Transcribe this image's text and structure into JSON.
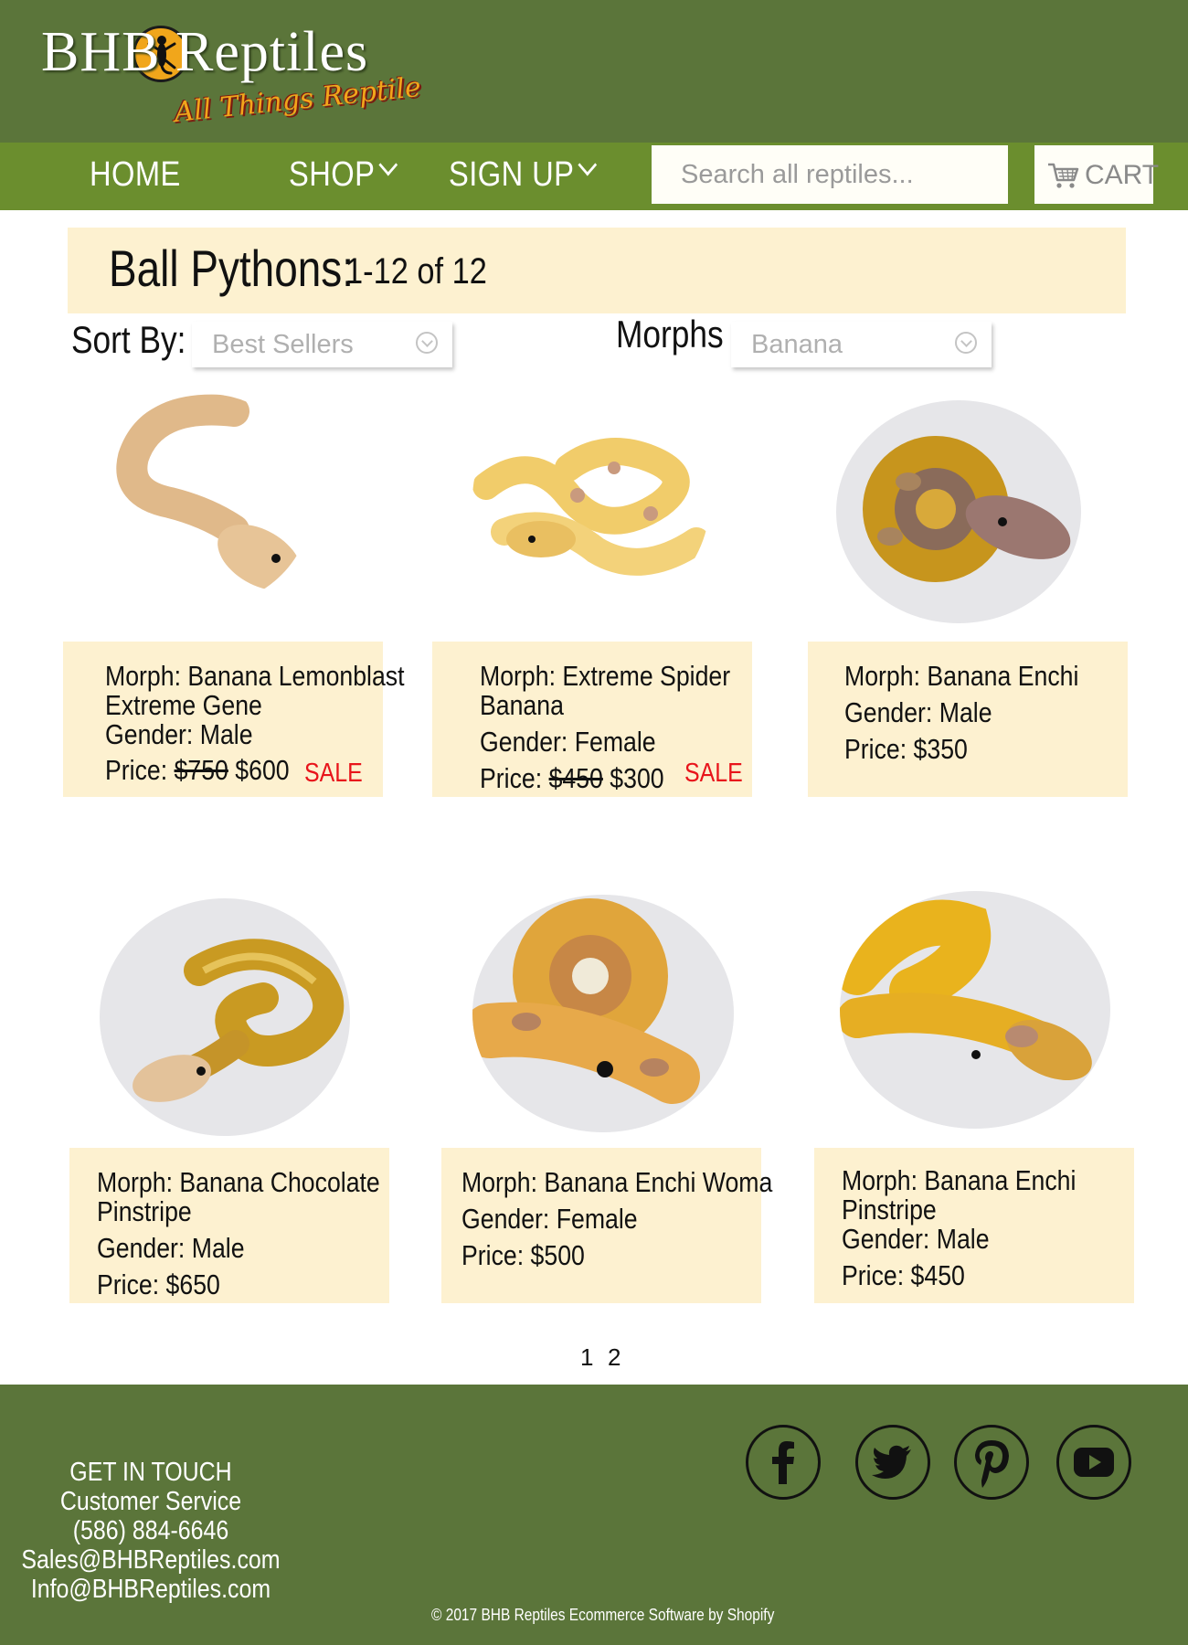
{
  "brand": {
    "name": "BHB Reptiles",
    "tagline": "All Things Reptile"
  },
  "nav": {
    "home": "HOME",
    "shop": "SHOP",
    "signup": "SIGN UP",
    "search_placeholder": "Search all reptiles...",
    "cart": "CART"
  },
  "page": {
    "title": "Ball Pythons:",
    "result_count": "1-12 of 12"
  },
  "filters": {
    "sort_label": "Sort By:",
    "sort_value": "Best Sellers",
    "morphs_label": "Morphs",
    "morphs_value": "Banana"
  },
  "products": [
    {
      "morph_line1": "Morph: Banana Lemonblast",
      "morph_line2": "Extreme Gene",
      "gender": "Gender: Male",
      "price_label": "Price:",
      "old_price": "$750",
      "price": "$600",
      "badge": "SALE"
    },
    {
      "morph_line1": "Morph: Extreme Spider",
      "morph_line2": "Banana",
      "gender": "Gender: Female",
      "price_label": "Price:",
      "old_price": "$450",
      "price": "$300",
      "badge": "SALE"
    },
    {
      "morph_line1": "Morph: Banana Enchi",
      "gender": "Gender: Male",
      "price": "Price: $350"
    },
    {
      "morph_line1": "Morph: Banana Chocolate",
      "morph_line2": "Pinstripe",
      "gender": "Gender: Male",
      "price": "Price: $650"
    },
    {
      "morph_line1": "Morph: Banana Enchi Woma",
      "gender": "Gender: Female",
      "price": "Price: $500"
    },
    {
      "morph_line1": "Morph: Banana Enchi",
      "morph_line2": "Pinstripe",
      "gender": "Gender: Male",
      "price": "Price: $450"
    }
  ],
  "pagination": [
    "1",
    "2"
  ],
  "footer": {
    "contact": [
      "GET IN TOUCH",
      "Customer Service",
      "(586) 884-6646",
      "Sales@BHBReptiles.com",
      "Info@BHBReptiles.com"
    ],
    "copyright": "© 2017 BHB Reptiles  Ecommerce Software by Shopify",
    "social": [
      "facebook-icon",
      "twitter-icon",
      "pinterest-icon",
      "youtube-icon"
    ]
  },
  "colors": {
    "header_green": "#5b753a",
    "nav_green": "#6b8e2e",
    "card_cream": "#fdf1d0",
    "sale_red": "#e8141b",
    "logo_orange": "#f1a61b"
  }
}
